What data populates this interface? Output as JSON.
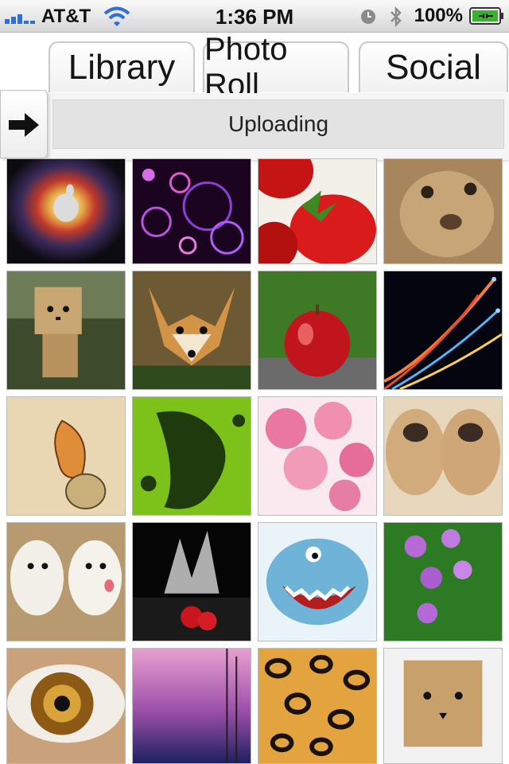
{
  "status_bar": {
    "carrier": "AT&T",
    "time": "1:36 PM",
    "battery_percent": "100%"
  },
  "tabs": [
    {
      "label": "Library"
    },
    {
      "label": "Photo Roll"
    },
    {
      "label": "Social"
    }
  ],
  "upload": {
    "label": "Uploading"
  },
  "photos": [
    {
      "icon": "apple-logo-photo"
    },
    {
      "icon": "purple-bokeh-photo"
    },
    {
      "icon": "strawberry-photo"
    },
    {
      "icon": "lion-cub-photo"
    },
    {
      "icon": "cardboard-robot-photo"
    },
    {
      "icon": "fox-photo"
    },
    {
      "icon": "red-apple-photo"
    },
    {
      "icon": "light-fibers-photo"
    },
    {
      "icon": "leaf-drawing-photo"
    },
    {
      "icon": "frog-silhouette-photo"
    },
    {
      "icon": "pink-roses-photo"
    },
    {
      "icon": "shar-pei-puppies-photo"
    },
    {
      "icon": "white-terriers-photo"
    },
    {
      "icon": "water-splash-photo"
    },
    {
      "icon": "cartoon-shark-photo"
    },
    {
      "icon": "purple-flowers-photo"
    },
    {
      "icon": "eye-closeup-photo"
    },
    {
      "icon": "sunset-photo"
    },
    {
      "icon": "leopard-print-photo"
    },
    {
      "icon": "cardboard-box-photo"
    }
  ]
}
